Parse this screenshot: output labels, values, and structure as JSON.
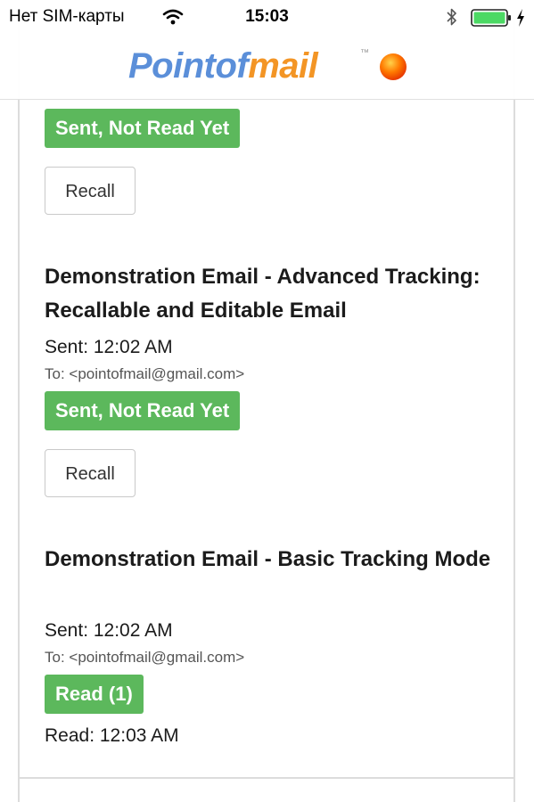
{
  "status_bar": {
    "carrier": "Нет SIM-карты",
    "time": "15:03",
    "wifi_icon": "wifi-icon",
    "bluetooth_icon": "bluetooth-icon",
    "battery_icon": "battery-full-icon",
    "charging_icon": "charging-bolt-icon"
  },
  "header": {
    "logo_part1": "Pointof",
    "logo_part2": "mail",
    "logo_tm": "™",
    "logo_colors": {
      "point": "#5b8fd9",
      "mail": "#f39525",
      "dot": "#ff6a00"
    }
  },
  "emails": [
    {
      "title": "",
      "sent": "",
      "to": "",
      "status": "Sent, Not Read Yet",
      "recall_label": "Recall"
    },
    {
      "title": "Demonstration Email - Advanced Tracking: Recallable and Editable Email",
      "sent": "Sent: 12:02 AM",
      "to": "To: <pointofmail@gmail.com>",
      "status": "Sent, Not Read Yet",
      "recall_label": "Recall"
    },
    {
      "title": "Demonstration Email - Basic Tracking Mode",
      "sent": "Sent: 12:02 AM",
      "to": "To: <pointofmail@gmail.com>",
      "status": "Read (1)",
      "read_at": "Read: 12:03 AM"
    }
  ],
  "colors": {
    "badge_green": "#5cb85c",
    "card_border": "#dcdcdc"
  }
}
